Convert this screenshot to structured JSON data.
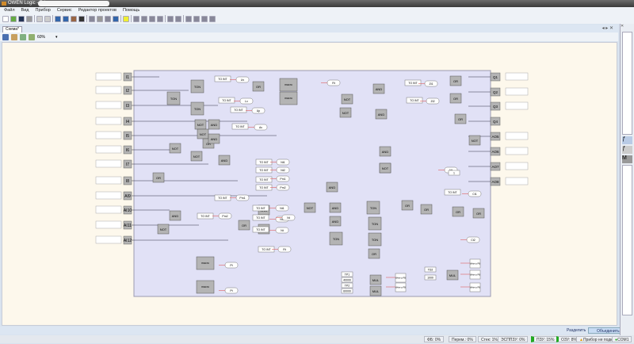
{
  "window": {
    "title": "OWEN Logic - D:\\"
  },
  "menu": [
    "Файл",
    "Вид",
    "Прибор",
    "Сервис",
    "Редактор проектов",
    "Помощь"
  ],
  "tabs": [
    {
      "label": "Схема*"
    }
  ],
  "zoom": {
    "value": "60%"
  },
  "diagram": {
    "inputs": [
      "I1",
      "I2",
      "I3",
      "I4",
      "I5",
      "I6",
      "I7",
      "I8",
      "AI9",
      "AI10",
      "AI11",
      "AI12"
    ],
    "outputs": [
      "Q1",
      "Q2",
      "Q3",
      "Q4",
      "AO5",
      "AO6",
      "AO7",
      "AO8"
    ],
    "blocks": [
      "TON",
      "TON",
      "TON",
      "NOT",
      "NOT",
      "OR",
      "NOT",
      "AND",
      "AND",
      "NOT",
      "AND",
      "OR",
      "OR",
      "NOT",
      "NOT",
      "AND",
      "AND",
      "AND",
      "AND",
      "OR",
      "OR",
      "OR",
      "NOT",
      "NOT",
      "AND",
      "AND",
      "AND",
      "TON",
      "TON",
      "TON",
      "TON",
      "OR",
      "OR",
      "OR",
      "OR",
      "OR",
      "NOT",
      "AND",
      "AND",
      "AND",
      "NOT",
      "OR",
      "MUL",
      "MUL",
      "MUL"
    ],
    "converters": [
      "TO INT",
      "TO INT",
      "TO INT",
      "TO INT",
      "TO INT",
      "TO INT",
      "TO INT",
      "TO INT",
      "TO INT",
      "TO INT",
      "TO INT",
      "TO INT",
      "TO INT",
      "TO INT",
      "TO INT",
      "TO INT",
      "TO INT"
    ],
    "variables": [
      "Uv",
      "Lv",
      "Up",
      "Av",
      "Zt1",
      "Zt2",
      "Nt1",
      "Nt2",
      "Pm1",
      "Pm2",
      "Pm1",
      "Pm2",
      "Nt1",
      "Nt2",
      "Nt",
      "Ct1",
      "Ct2",
      "Pt",
      "Pt",
      "Rt",
      "Rt",
      "Nt",
      "Nt"
    ],
    "constants": [
      "TP1",
      "40000",
      "TP2",
      "60000",
      "TD2",
      "1000",
      "1"
    ],
    "write_blocks": [
      "Write to PB",
      "Write to PB",
      "Write to PB",
      "Write to PB",
      "Write to PB"
    ],
    "macros": [
      "macro",
      "macro",
      "macro",
      "macro"
    ]
  },
  "bottom": {
    "split": "Разделить",
    "merge": "Объединить"
  },
  "status": {
    "fb": "ФБ: 0%",
    "vars": "Перем.: 0%",
    "stack": "Стек: 1%",
    "eeprom": "ЭСППЗУ: 0%",
    "rom": "ПЗУ: 15%",
    "ram": "ОЗУ: 8%",
    "device": "Прибор не подключен",
    "port": "COM1"
  },
  "colors": {
    "frame": "#e1e1f6",
    "block": "#b4b4b4",
    "canvas": "#fdf8ec",
    "wire": "#333344",
    "link": "#e06060"
  }
}
